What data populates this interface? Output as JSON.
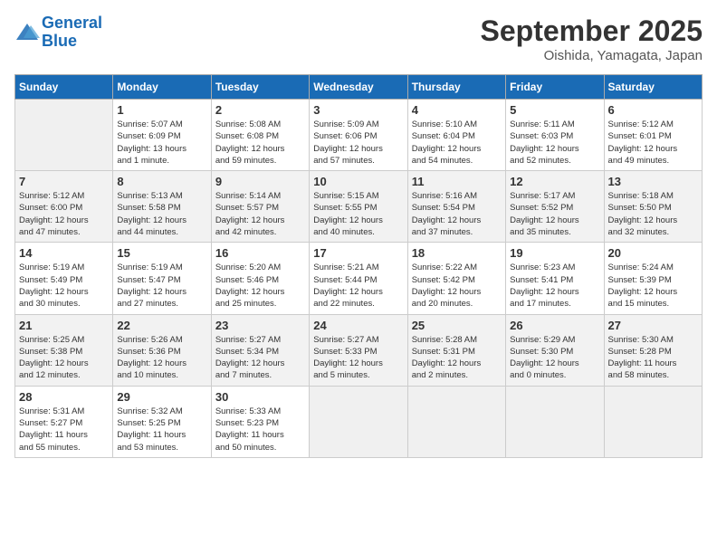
{
  "header": {
    "logo_line1": "General",
    "logo_line2": "Blue",
    "month_title": "September 2025",
    "location": "Oishida, Yamagata, Japan"
  },
  "weekdays": [
    "Sunday",
    "Monday",
    "Tuesday",
    "Wednesday",
    "Thursday",
    "Friday",
    "Saturday"
  ],
  "weeks": [
    [
      {
        "day": "",
        "detail": ""
      },
      {
        "day": "1",
        "detail": "Sunrise: 5:07 AM\nSunset: 6:09 PM\nDaylight: 13 hours\nand 1 minute."
      },
      {
        "day": "2",
        "detail": "Sunrise: 5:08 AM\nSunset: 6:08 PM\nDaylight: 12 hours\nand 59 minutes."
      },
      {
        "day": "3",
        "detail": "Sunrise: 5:09 AM\nSunset: 6:06 PM\nDaylight: 12 hours\nand 57 minutes."
      },
      {
        "day": "4",
        "detail": "Sunrise: 5:10 AM\nSunset: 6:04 PM\nDaylight: 12 hours\nand 54 minutes."
      },
      {
        "day": "5",
        "detail": "Sunrise: 5:11 AM\nSunset: 6:03 PM\nDaylight: 12 hours\nand 52 minutes."
      },
      {
        "day": "6",
        "detail": "Sunrise: 5:12 AM\nSunset: 6:01 PM\nDaylight: 12 hours\nand 49 minutes."
      }
    ],
    [
      {
        "day": "7",
        "detail": "Sunrise: 5:12 AM\nSunset: 6:00 PM\nDaylight: 12 hours\nand 47 minutes."
      },
      {
        "day": "8",
        "detail": "Sunrise: 5:13 AM\nSunset: 5:58 PM\nDaylight: 12 hours\nand 44 minutes."
      },
      {
        "day": "9",
        "detail": "Sunrise: 5:14 AM\nSunset: 5:57 PM\nDaylight: 12 hours\nand 42 minutes."
      },
      {
        "day": "10",
        "detail": "Sunrise: 5:15 AM\nSunset: 5:55 PM\nDaylight: 12 hours\nand 40 minutes."
      },
      {
        "day": "11",
        "detail": "Sunrise: 5:16 AM\nSunset: 5:54 PM\nDaylight: 12 hours\nand 37 minutes."
      },
      {
        "day": "12",
        "detail": "Sunrise: 5:17 AM\nSunset: 5:52 PM\nDaylight: 12 hours\nand 35 minutes."
      },
      {
        "day": "13",
        "detail": "Sunrise: 5:18 AM\nSunset: 5:50 PM\nDaylight: 12 hours\nand 32 minutes."
      }
    ],
    [
      {
        "day": "14",
        "detail": "Sunrise: 5:19 AM\nSunset: 5:49 PM\nDaylight: 12 hours\nand 30 minutes."
      },
      {
        "day": "15",
        "detail": "Sunrise: 5:19 AM\nSunset: 5:47 PM\nDaylight: 12 hours\nand 27 minutes."
      },
      {
        "day": "16",
        "detail": "Sunrise: 5:20 AM\nSunset: 5:46 PM\nDaylight: 12 hours\nand 25 minutes."
      },
      {
        "day": "17",
        "detail": "Sunrise: 5:21 AM\nSunset: 5:44 PM\nDaylight: 12 hours\nand 22 minutes."
      },
      {
        "day": "18",
        "detail": "Sunrise: 5:22 AM\nSunset: 5:42 PM\nDaylight: 12 hours\nand 20 minutes."
      },
      {
        "day": "19",
        "detail": "Sunrise: 5:23 AM\nSunset: 5:41 PM\nDaylight: 12 hours\nand 17 minutes."
      },
      {
        "day": "20",
        "detail": "Sunrise: 5:24 AM\nSunset: 5:39 PM\nDaylight: 12 hours\nand 15 minutes."
      }
    ],
    [
      {
        "day": "21",
        "detail": "Sunrise: 5:25 AM\nSunset: 5:38 PM\nDaylight: 12 hours\nand 12 minutes."
      },
      {
        "day": "22",
        "detail": "Sunrise: 5:26 AM\nSunset: 5:36 PM\nDaylight: 12 hours\nand 10 minutes."
      },
      {
        "day": "23",
        "detail": "Sunrise: 5:27 AM\nSunset: 5:34 PM\nDaylight: 12 hours\nand 7 minutes."
      },
      {
        "day": "24",
        "detail": "Sunrise: 5:27 AM\nSunset: 5:33 PM\nDaylight: 12 hours\nand 5 minutes."
      },
      {
        "day": "25",
        "detail": "Sunrise: 5:28 AM\nSunset: 5:31 PM\nDaylight: 12 hours\nand 2 minutes."
      },
      {
        "day": "26",
        "detail": "Sunrise: 5:29 AM\nSunset: 5:30 PM\nDaylight: 12 hours\nand 0 minutes."
      },
      {
        "day": "27",
        "detail": "Sunrise: 5:30 AM\nSunset: 5:28 PM\nDaylight: 11 hours\nand 58 minutes."
      }
    ],
    [
      {
        "day": "28",
        "detail": "Sunrise: 5:31 AM\nSunset: 5:27 PM\nDaylight: 11 hours\nand 55 minutes."
      },
      {
        "day": "29",
        "detail": "Sunrise: 5:32 AM\nSunset: 5:25 PM\nDaylight: 11 hours\nand 53 minutes."
      },
      {
        "day": "30",
        "detail": "Sunrise: 5:33 AM\nSunset: 5:23 PM\nDaylight: 11 hours\nand 50 minutes."
      },
      {
        "day": "",
        "detail": ""
      },
      {
        "day": "",
        "detail": ""
      },
      {
        "day": "",
        "detail": ""
      },
      {
        "day": "",
        "detail": ""
      }
    ]
  ]
}
